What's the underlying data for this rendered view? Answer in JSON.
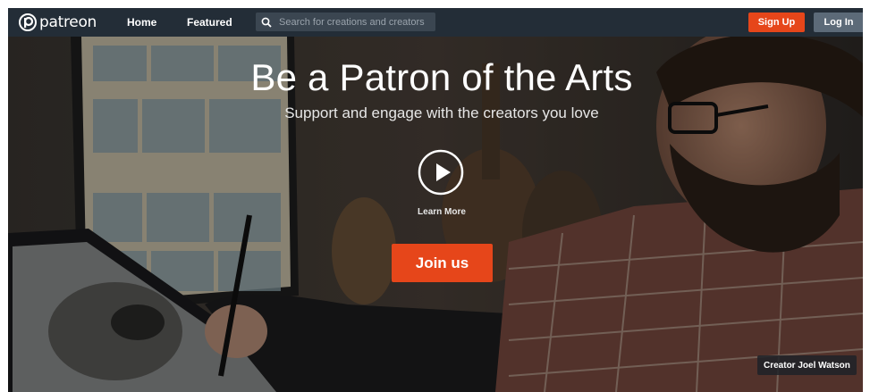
{
  "nav": {
    "brand": "patreon",
    "links": [
      {
        "label": "Home"
      },
      {
        "label": "Featured"
      }
    ],
    "search": {
      "placeholder": "Search for creations and creators",
      "value": ""
    },
    "signup_label": "Sign Up",
    "login_label": "Log In"
  },
  "hero": {
    "title": "Be a Patron of the Arts",
    "subtitle": "Support and engage with the creators you love",
    "learn_more_label": "Learn More",
    "join_label": "Join us",
    "credit": "Creator Joel Watson"
  },
  "colors": {
    "accent": "#e6461a",
    "nav_bg": "#232d37",
    "login_bg": "#5c6a78"
  },
  "icons": [
    "patreon-logo-icon",
    "search-icon",
    "play-icon"
  ]
}
